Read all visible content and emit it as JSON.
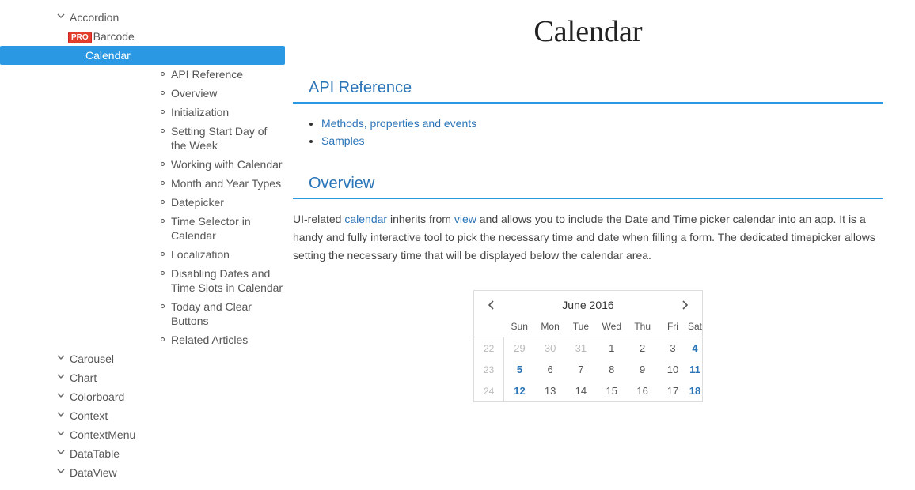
{
  "sidebar": {
    "pro_label": "PRO",
    "items": [
      {
        "label": "Accordion",
        "type": "branch"
      },
      {
        "label": "Barcode",
        "type": "pro"
      },
      {
        "label": "Calendar",
        "type": "branch-active",
        "children": [
          "API Reference",
          "Overview",
          "Initialization",
          "Setting Start Day of the Week",
          "Working with Calendar",
          "Month and Year Types",
          "Datepicker",
          "Time Selector in Calendar",
          "Localization",
          "Disabling Dates and Time Slots in Calendar",
          "Today and Clear Buttons",
          "Related Articles"
        ]
      },
      {
        "label": "Carousel",
        "type": "branch"
      },
      {
        "label": "Chart",
        "type": "branch"
      },
      {
        "label": "Colorboard",
        "type": "branch"
      },
      {
        "label": "Context",
        "type": "branch"
      },
      {
        "label": "ContextMenu",
        "type": "branch"
      },
      {
        "label": "DataTable",
        "type": "branch"
      },
      {
        "label": "DataView",
        "type": "branch"
      }
    ]
  },
  "page": {
    "title": "Calendar",
    "api_ref": {
      "heading": "API Reference",
      "links": [
        "Methods, properties and events",
        "Samples"
      ]
    },
    "overview": {
      "heading": "Overview",
      "pre": "UI-related ",
      "link1": "calendar",
      "mid": " inherits from ",
      "link2": "view",
      "post": " and allows you to include the Date and Time picker calendar into an app. It is a handy and fully interactive tool to pick the necessary time and date when filling a form. The dedicated timepicker allows setting the necessary time that will be displayed below the calendar area."
    }
  },
  "calendar": {
    "title": "June 2016",
    "dow": [
      "Sun",
      "Mon",
      "Tue",
      "Wed",
      "Thu",
      "Fri",
      "Sat"
    ],
    "weeks": [
      {
        "wk": "22",
        "days": [
          {
            "n": "29",
            "cls": "out"
          },
          {
            "n": "30",
            "cls": "out"
          },
          {
            "n": "31",
            "cls": "out"
          },
          {
            "n": "1"
          },
          {
            "n": "2"
          },
          {
            "n": "3"
          },
          {
            "n": "4",
            "cls": "blue"
          }
        ]
      },
      {
        "wk": "23",
        "days": [
          {
            "n": "5",
            "cls": "blue"
          },
          {
            "n": "6"
          },
          {
            "n": "7"
          },
          {
            "n": "8"
          },
          {
            "n": "9"
          },
          {
            "n": "10"
          },
          {
            "n": "11",
            "cls": "blue"
          }
        ]
      },
      {
        "wk": "24",
        "days": [
          {
            "n": "12",
            "cls": "blue"
          },
          {
            "n": "13"
          },
          {
            "n": "14"
          },
          {
            "n": "15"
          },
          {
            "n": "16"
          },
          {
            "n": "17"
          },
          {
            "n": "18",
            "cls": "blue"
          }
        ]
      }
    ]
  }
}
